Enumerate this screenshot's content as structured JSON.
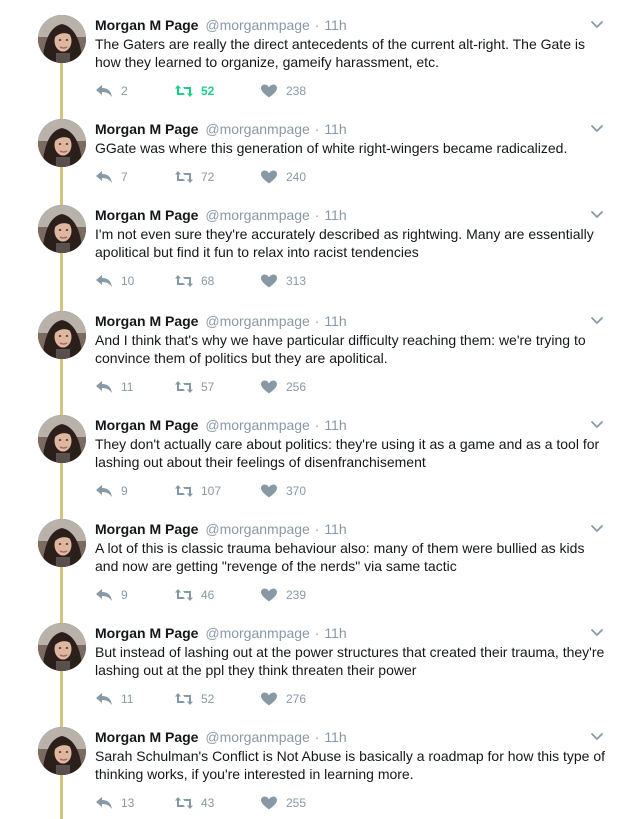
{
  "colors": {
    "thread_line": "#d4c47a",
    "meta_gray": "#8899a6",
    "retweet_active": "#19cf86"
  },
  "tweets": [
    {
      "name": "Morgan M Page",
      "handle": "@morganmpage",
      "separator": "·",
      "time": "11h",
      "text": "The Gaters are really the direct antecedents of the current alt-right. The Gate is how they learned to organize, gameify harassment, etc.",
      "replies": "2",
      "retweets": "52",
      "likes": "238",
      "retweeted": true
    },
    {
      "name": "Morgan M Page",
      "handle": "@morganmpage",
      "separator": "·",
      "time": "11h",
      "text": "GGate was where this generation of white right-wingers became radicalized.",
      "replies": "7",
      "retweets": "72",
      "likes": "240",
      "retweeted": false
    },
    {
      "name": "Morgan M Page",
      "handle": "@morganmpage",
      "separator": "·",
      "time": "11h",
      "text": "I'm not even sure they're accurately described as rightwing. Many are essentially apolitical but find it fun to relax into racist tendencies",
      "replies": "10",
      "retweets": "68",
      "likes": "313",
      "retweeted": false
    },
    {
      "name": "Morgan M Page",
      "handle": "@morganmpage",
      "separator": "·",
      "time": "11h",
      "text": "And I think that's why we have particular difficulty reaching them: we're trying to convince them of politics but they are apolitical.",
      "replies": "11",
      "retweets": "57",
      "likes": "256",
      "retweeted": false
    },
    {
      "name": "Morgan M Page",
      "handle": "@morganmpage",
      "separator": "·",
      "time": "11h",
      "text": "They don't actually care about politics: they're using it as a game and as a tool for lashing out about their feelings of disenfranchisement",
      "replies": "9",
      "retweets": "107",
      "likes": "370",
      "retweeted": false
    },
    {
      "name": "Morgan M Page",
      "handle": "@morganmpage",
      "separator": "·",
      "time": "11h",
      "text": "A lot of this is classic trauma behaviour also: many of them were bullied as kids and now are getting \"revenge of the nerds\" via same tactic",
      "replies": "9",
      "retweets": "46",
      "likes": "239",
      "retweeted": false
    },
    {
      "name": "Morgan M Page",
      "handle": "@morganmpage",
      "separator": "·",
      "time": "11h",
      "text": "But instead of lashing out at the power structures that created their trauma, they're lashing out at the ppl they think threaten their power",
      "replies": "11",
      "retweets": "52",
      "likes": "276",
      "retweeted": false
    },
    {
      "name": "Morgan M Page",
      "handle": "@morganmpage",
      "separator": "·",
      "time": "11h",
      "text": "Sarah Schulman's Conflict is Not Abuse is basically a roadmap for how this type of thinking works, if you're interested in learning more.",
      "replies": "13",
      "retweets": "43",
      "likes": "255",
      "retweeted": false
    }
  ]
}
